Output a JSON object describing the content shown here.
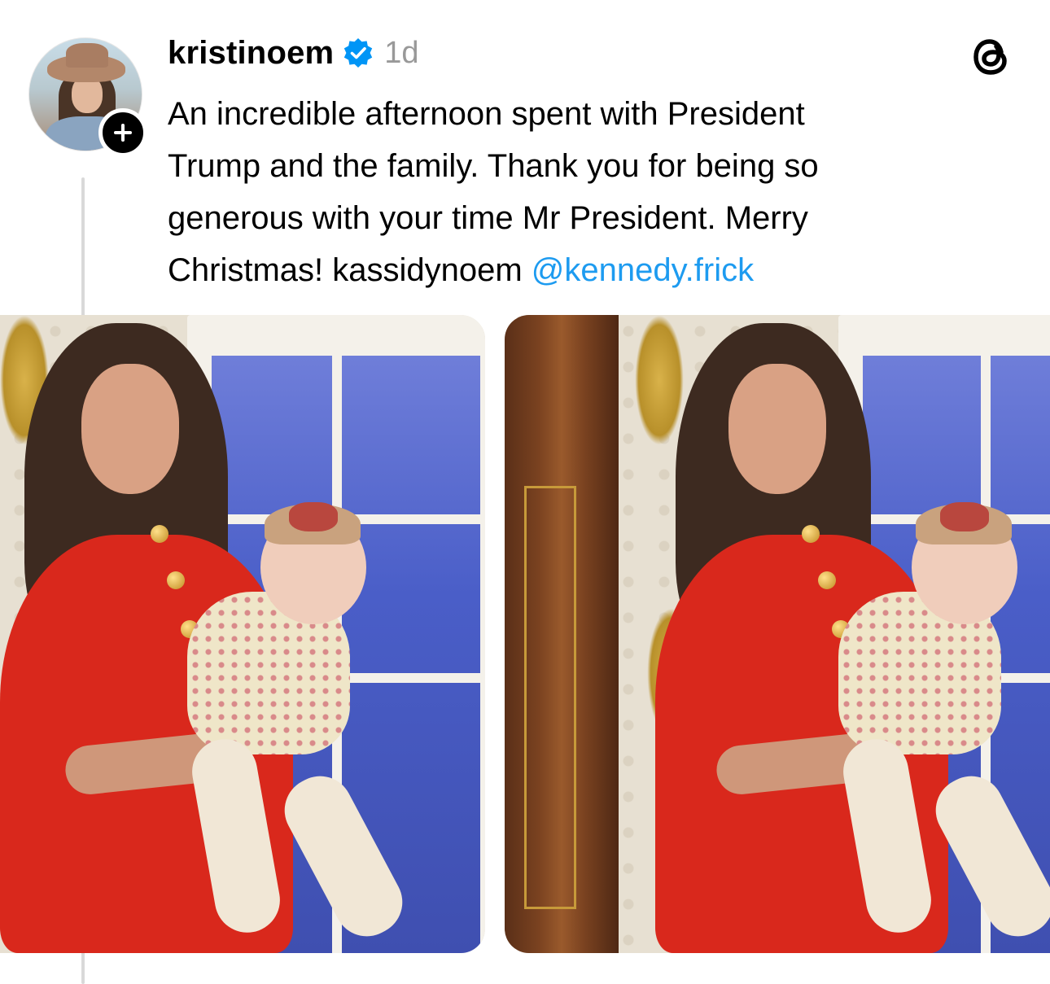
{
  "post": {
    "username": "kristinoem",
    "verified": true,
    "timestamp": "1d",
    "caption_text": "An incredible afternoon spent with President\nTrump and the family.  Thank you for being so\ngenerous with your time Mr President. Merry\nChristmas! kassidynoem ",
    "mention": "@kennedy.frick"
  },
  "icons": {
    "avatar": "profile-photo",
    "follow": "plus-icon",
    "verified": "verified-badge-icon",
    "app": "threads-logo-icon"
  },
  "colors": {
    "mention": "#1d9bf0",
    "verified": "#0095f6",
    "timestamp": "#999999",
    "thread_line": "#d9d9d9"
  },
  "media": {
    "count": 2
  }
}
